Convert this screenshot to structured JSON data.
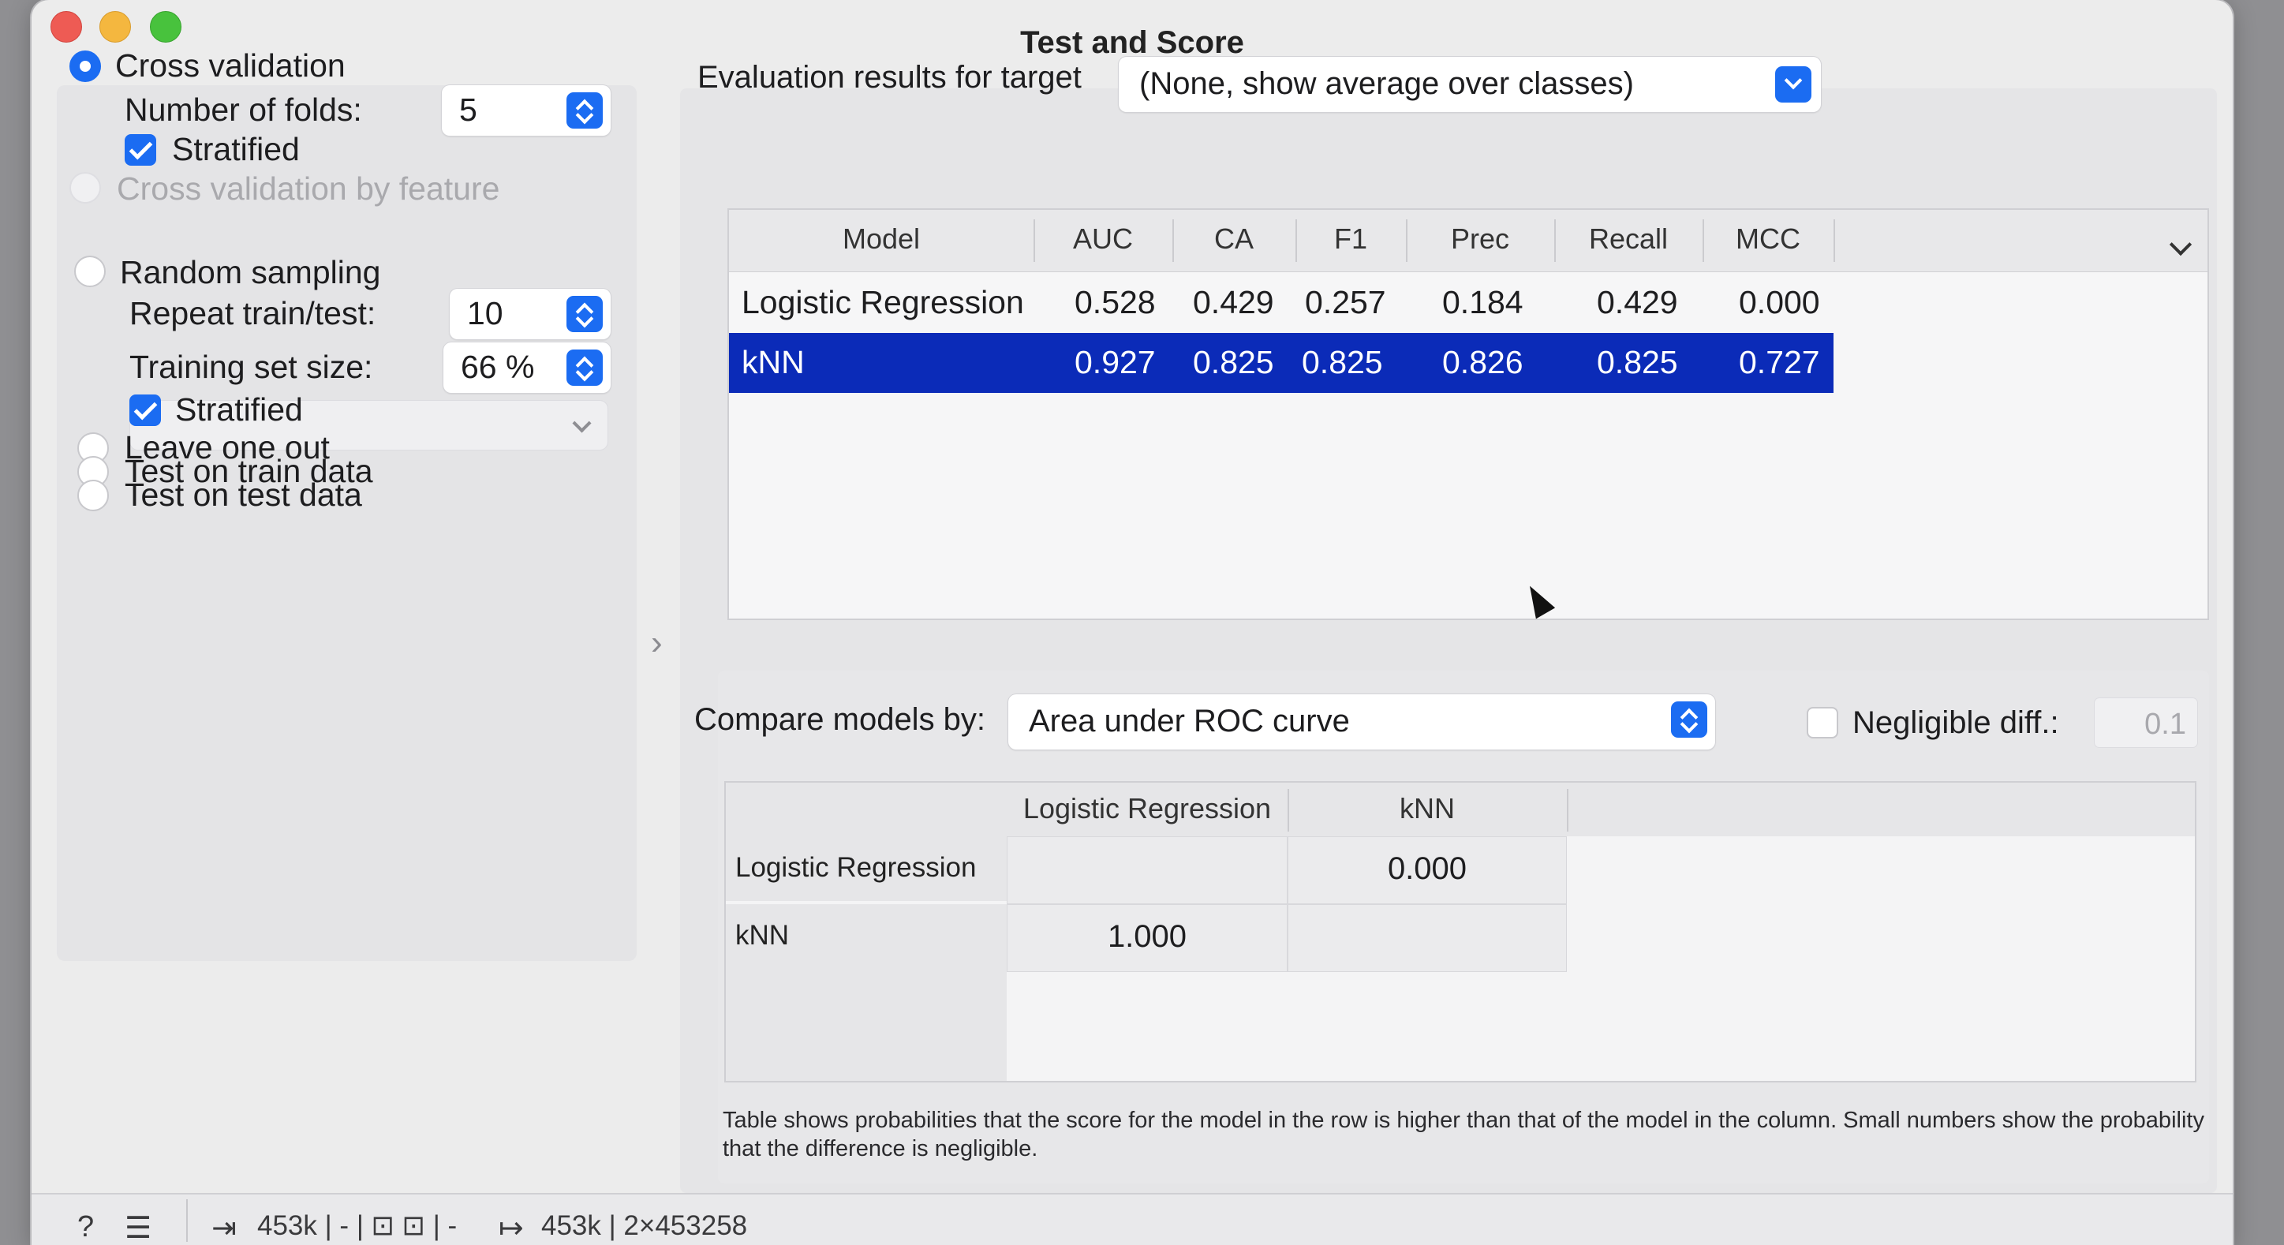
{
  "window": {
    "title": "Test and Score"
  },
  "sampling": {
    "cross_validation": {
      "label": "Cross validation",
      "selected": true
    },
    "folds_label": "Number of folds:",
    "folds_value": "5",
    "stratified_cv": {
      "label": "Stratified",
      "checked": true
    },
    "cv_by_feature": {
      "label": "Cross validation by feature",
      "enabled": false
    },
    "random_sampling": {
      "label": "Random sampling",
      "selected": false
    },
    "repeat_label": "Repeat train/test:",
    "repeat_value": "10",
    "train_size_label": "Training set size:",
    "train_size_value": "66 %",
    "stratified_rs": {
      "label": "Stratified",
      "checked": true
    },
    "leave_one_out": "Leave one out",
    "test_on_train": "Test on train data",
    "test_on_test": "Test on test data"
  },
  "evaluation": {
    "target_label": "Evaluation results for target",
    "target_value": "(None, show average over classes)",
    "columns": [
      "Model",
      "AUC",
      "CA",
      "F1",
      "Prec",
      "Recall",
      "MCC"
    ],
    "rows": [
      {
        "model": "Logistic Regression",
        "auc": "0.528",
        "ca": "0.429",
        "f1": "0.257",
        "prec": "0.184",
        "recall": "0.429",
        "mcc": "0.000",
        "selected": false
      },
      {
        "model": "kNN",
        "auc": "0.927",
        "ca": "0.825",
        "f1": "0.825",
        "prec": "0.826",
        "recall": "0.825",
        "mcc": "0.727",
        "selected": true
      }
    ]
  },
  "comparison": {
    "compare_label": "Compare models by:",
    "compare_value": "Area under ROC curve",
    "negligible_label": "Negligible diff.:",
    "negligible_checked": false,
    "negligible_value": "0.1",
    "columns": [
      "Logistic Regression",
      "kNN"
    ],
    "rows": [
      {
        "label": "Logistic Regression",
        "cells": [
          "",
          "0.000"
        ]
      },
      {
        "label": "kNN",
        "cells": [
          "1.000",
          ""
        ]
      }
    ],
    "note": "Table shows probabilities that the score for the model in the row is higher than that of the model in the column. Small numbers show the probability that the difference is negligible."
  },
  "status": {
    "input_summary": "453k | - | ⊡ ⊡ | -",
    "output_summary": "453k | 2×453258"
  },
  "colors": {
    "accent": "#1b6cf2",
    "selection": "#0b2bb8"
  }
}
